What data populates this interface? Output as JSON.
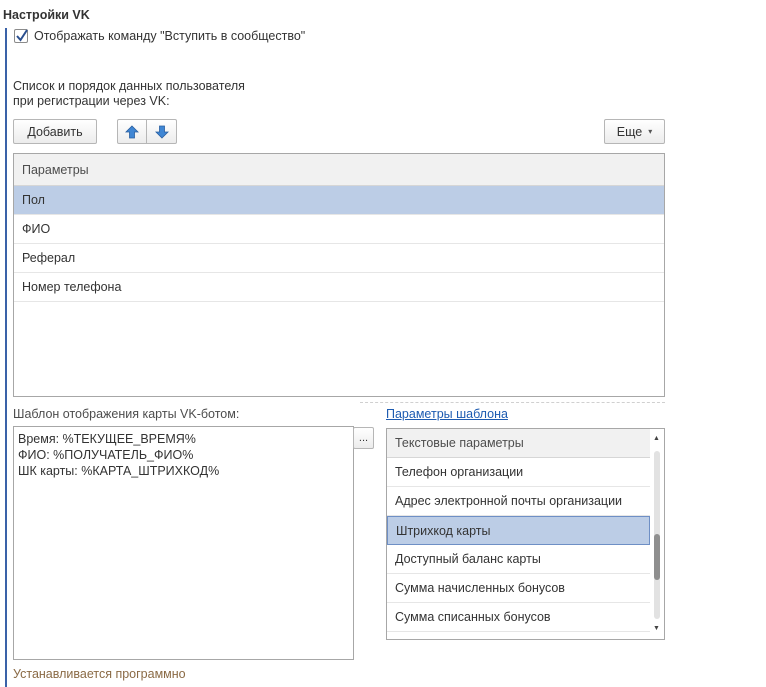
{
  "section": {
    "title": "Настройки VK"
  },
  "join_checkbox": {
    "label": "Отображать команду \"Вступить в сообщество\"",
    "checked": true
  },
  "description": {
    "line1": "Список и порядок данных пользователя",
    "line2": "при регистрации через VK:"
  },
  "toolbar": {
    "add_label": "Добавить",
    "up_icon": "arrow-up-icon",
    "down_icon": "arrow-down-icon",
    "more_label": "Еще",
    "more_caret": "▾"
  },
  "params_table": {
    "header": "Параметры",
    "rows": [
      "Пол",
      "ФИО",
      "Реферал",
      "Номер телефона"
    ],
    "selected_index": 0
  },
  "template": {
    "label": "Шаблон отображения карты VK-ботом:",
    "text": "Время: %ТЕКУЩЕЕ_ВРЕМЯ%\nФИО: %ПОЛУЧАТЕЛЬ_ФИО%\nШК карты: %КАРТА_ШТРИХКОД%",
    "ellipsis": "..."
  },
  "template_params": {
    "link": "Параметры шаблона",
    "header": "Текстовые параметры",
    "items": [
      "Телефон организации",
      "Адрес электронной почты организации",
      "Штрихкод карты",
      "Доступный баланс карты",
      "Сумма начисленных бонусов",
      "Сумма списанных бонусов"
    ],
    "selected_index": 2,
    "scroll_up": "▲",
    "scroll_down": "▼"
  },
  "footer": {
    "note": "Устанавливается программно"
  },
  "colors": {
    "accent": "#3a62a8",
    "selection": "#bccde6",
    "link": "#1d5bb1",
    "note": "#8a6a45"
  }
}
